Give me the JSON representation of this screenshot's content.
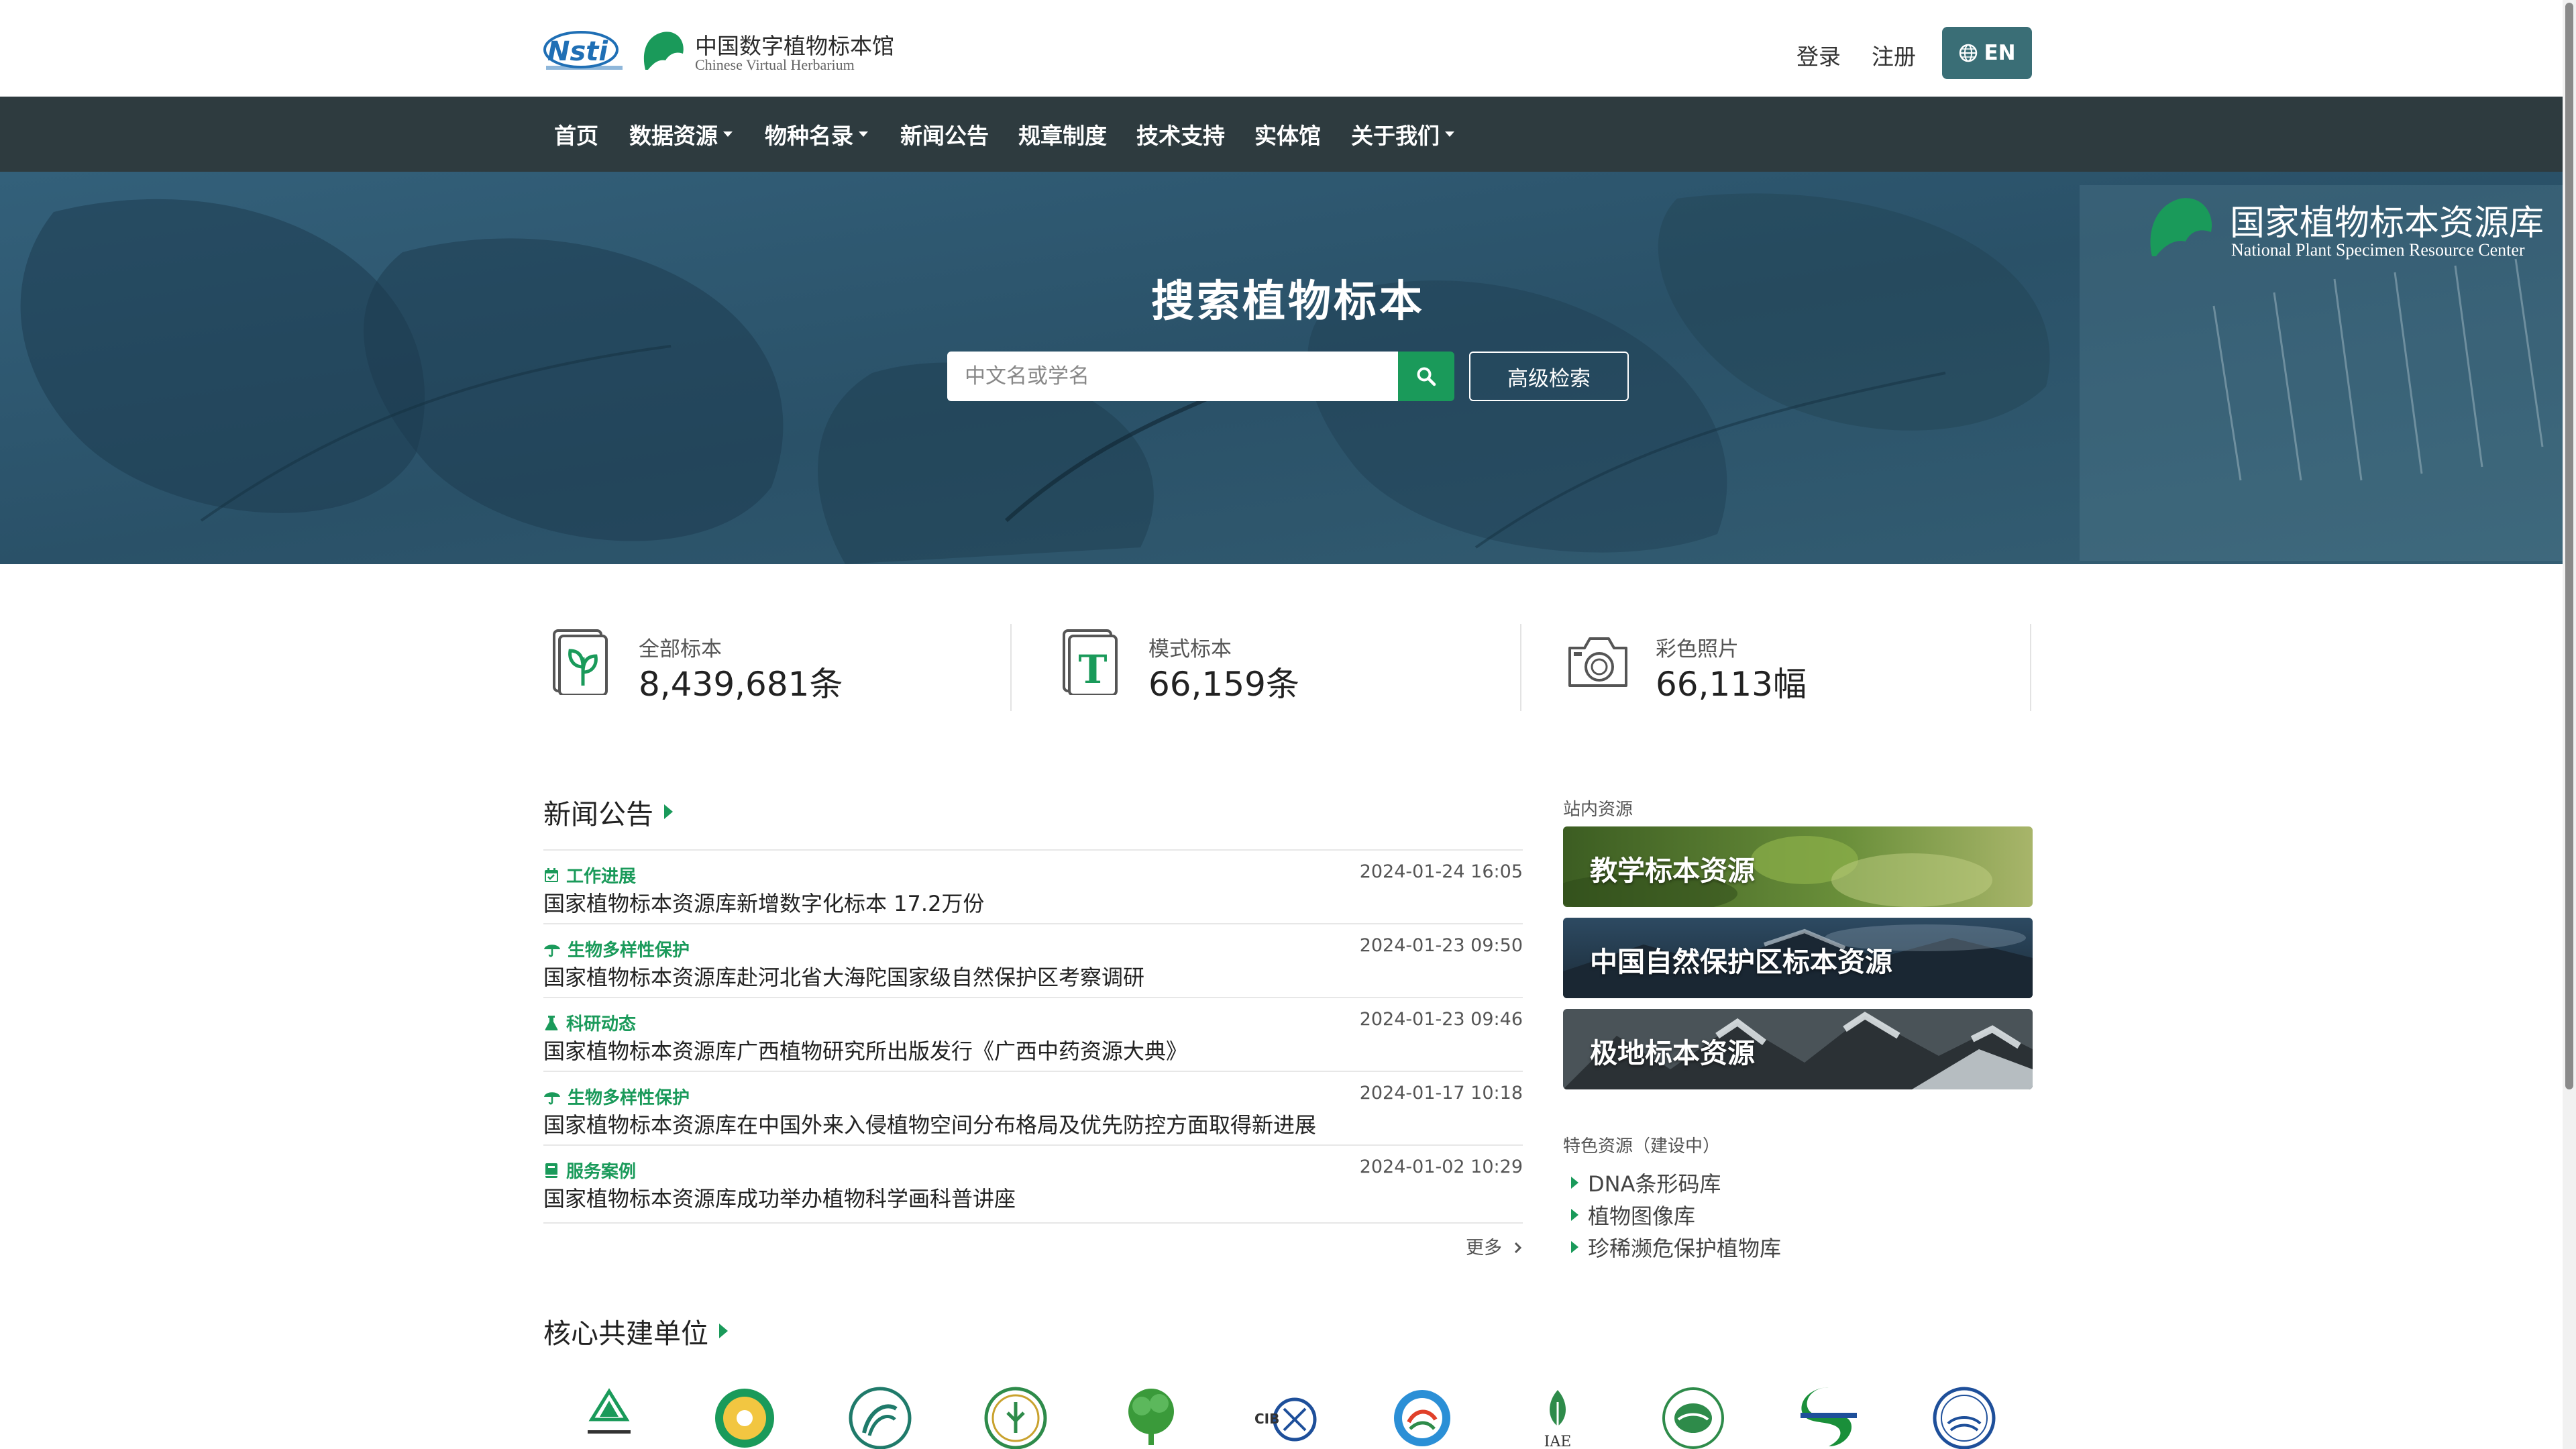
{
  "header": {
    "logo_nsti_text": "Nsti",
    "site_title": "中国数字植物标本馆",
    "site_subtitle": "Chinese Virtual Herbarium",
    "login": "登录",
    "register": "注册",
    "lang_button": "EN"
  },
  "nav": {
    "items": [
      {
        "label": "首页",
        "dropdown": false
      },
      {
        "label": "数据资源",
        "dropdown": true
      },
      {
        "label": "物种名录",
        "dropdown": true
      },
      {
        "label": "新闻公告",
        "dropdown": false
      },
      {
        "label": "规章制度",
        "dropdown": false
      },
      {
        "label": "技术支持",
        "dropdown": false
      },
      {
        "label": "实体馆",
        "dropdown": false
      },
      {
        "label": "关于我们",
        "dropdown": true
      }
    ]
  },
  "hero": {
    "title": "搜索植物标本",
    "search_placeholder": "中文名或学名",
    "advanced_search": "高级检索",
    "center_title": "国家植物标本资源库",
    "center_subtitle": "National Plant Specimen Resource Center"
  },
  "stats": [
    {
      "label": "全部标本",
      "value": "8,439,681条",
      "icon": "plant-specimen-icon"
    },
    {
      "label": "模式标本",
      "value": "66,159条",
      "icon": "type-specimen-icon"
    },
    {
      "label": "彩色照片",
      "value": "66,113幅",
      "icon": "camera-icon"
    }
  ],
  "news": {
    "title": "新闻公告",
    "more": "更多",
    "items": [
      {
        "category": "工作进展",
        "title": "国家植物标本资源库新增数字化标本 17.2万份",
        "date": "2024-01-24 16:05"
      },
      {
        "category": "生物多样性保护",
        "title": "国家植物标本资源库赴河北省大海陀国家级自然保护区考察调研",
        "date": "2024-01-23 09:50"
      },
      {
        "category": "科研动态",
        "title": "国家植物标本资源库广西植物研究所出版发行《广西中药资源大典》",
        "date": "2024-01-23 09:46"
      },
      {
        "category": "生物多样性保护",
        "title": "国家植物标本资源库在中国外来入侵植物空间分布格局及优先防控方面取得新进展",
        "date": "2024-01-17 10:18"
      },
      {
        "category": "服务案例",
        "title": "国家植物标本资源库成功举办植物科学画科普讲座",
        "date": "2024-01-02 10:29"
      }
    ]
  },
  "side": {
    "internal_label": "站内资源",
    "cards": [
      "教学标本资源",
      "中国自然保护区标本资源",
      "极地标本资源"
    ],
    "featured_label": "特色资源（建设中）",
    "featured": [
      "DNA条形码库",
      "植物图像库",
      "珍稀濒危保护植物库"
    ]
  },
  "partners": {
    "title": "核心共建单位",
    "logo_texts": [
      "CIB",
      "IAE"
    ]
  },
  "colors": {
    "accent_green": "#1a9a5a",
    "nav_bg": "#2e3b3f",
    "lang_button_bg": "#3a6e76"
  }
}
